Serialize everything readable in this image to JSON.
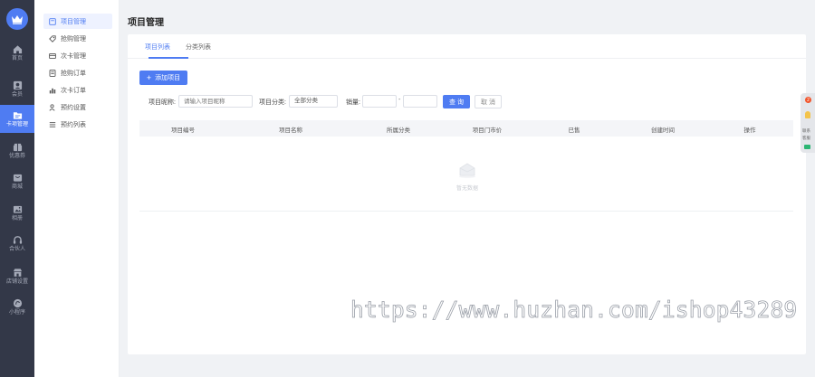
{
  "colors": {
    "accent": "#4f7cf2",
    "sidebar_bg": "#333848",
    "empty_text": "#c9ccd2"
  },
  "main_nav": [
    {
      "label": "首页",
      "icon": "home-icon"
    },
    {
      "label": "会员",
      "icon": "member-icon"
    },
    {
      "label": "卡项管理",
      "icon": "folder-icon",
      "active": true
    },
    {
      "label": "优惠券",
      "icon": "coupon-icon"
    },
    {
      "label": "商城",
      "icon": "mall-icon"
    },
    {
      "label": "相册",
      "icon": "album-icon"
    },
    {
      "label": "合伙人",
      "icon": "partner-icon"
    },
    {
      "label": "店铺设置",
      "icon": "store-icon"
    },
    {
      "label": "小程序",
      "icon": "miniapp-icon"
    }
  ],
  "sub_nav": [
    {
      "label": "项目管理",
      "icon": "box-icon",
      "active": true
    },
    {
      "label": "抢购管理",
      "icon": "tag-icon"
    },
    {
      "label": "次卡管理",
      "icon": "card-icon"
    },
    {
      "label": "抢购订单",
      "icon": "order-icon"
    },
    {
      "label": "次卡订单",
      "icon": "chart-icon"
    },
    {
      "label": "预约设置",
      "icon": "user-setting-icon"
    },
    {
      "label": "预约列表",
      "icon": "list-icon"
    }
  ],
  "page": {
    "title": "项目管理"
  },
  "tabs": [
    {
      "label": "项目列表",
      "active": true
    },
    {
      "label": "分类列表"
    }
  ],
  "toolbar": {
    "add_label": "添加项目",
    "add_icon": "plus-icon"
  },
  "filters": {
    "name_label": "项目昵称:",
    "name_placeholder": "请输入项目昵称",
    "category_label": "项目分类:",
    "category_value": "全部分类",
    "sales_label": "销量:",
    "range_sep": "-",
    "query_label": "查 询",
    "cancel_label": "取 消"
  },
  "table": {
    "columns": [
      "项目编号",
      "项目名称",
      "所属分类",
      "项目门市价",
      "已售",
      "创建时间",
      "操作"
    ],
    "rows": [],
    "empty_text": "暂无数据"
  },
  "float_bar": {
    "badge": "2",
    "labels": [
      "联系",
      "客服"
    ]
  },
  "watermark": "https://www.huzhan.com/ishop43289"
}
